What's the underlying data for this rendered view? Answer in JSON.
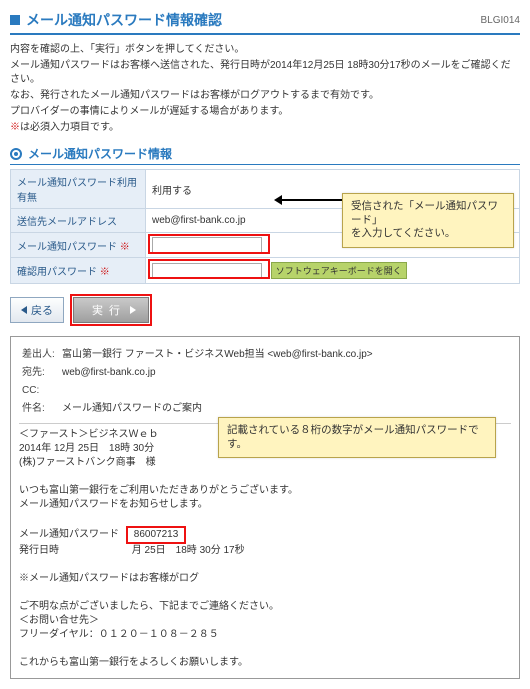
{
  "header": {
    "title": "メール通知パスワード情報確認",
    "code": "BLGI014"
  },
  "intro": {
    "l1": "内容を確認の上、「実行」ボタンを押してください。",
    "l2": "メール通知パスワードはお客様へ送信された、発行日時が2014年12月25日 18時30分17秒のメールをご確認ください。",
    "l3": "なお、発行されたメール通知パスワードはお客様がログアウトするまで有効です。",
    "l4": "プロバイダーの事情によりメールが遅延する場合があります。",
    "l5_mark": "※",
    "l5_text": "は必須入力項目です。"
  },
  "section": {
    "title": "メール通知パスワード情報"
  },
  "table": {
    "r1h": "メール通知パスワード利用有無",
    "r1v": "利用する",
    "r2h": "送信先メールアドレス",
    "r2v": "web@first-bank.co.jp",
    "r3h": "メール通知パスワード",
    "r4h": "確認用パスワード",
    "req": "※",
    "swkb": "ソフトウェアキーボードを開く"
  },
  "buttons": {
    "back": "戻る",
    "exec": "実行"
  },
  "callouts": {
    "c1a": "受信された「メール通知パスワード」",
    "c1b": "を入力してください。",
    "c2": "記載されている８桁の数字がメール通知パスワードです。"
  },
  "mail": {
    "h_from_l": "差出人:",
    "h_from_v": "富山第一銀行 ファースト・ビジネスWeb担当 <web@first-bank.co.jp>",
    "h_to_l": "宛先:",
    "h_to_v": "web@first-bank.co.jp",
    "h_cc_l": "CC:",
    "h_cc_v": "",
    "h_sub_l": "件名:",
    "h_sub_v": "メール通知パスワードのご案内",
    "b1": "＜ファースト＞ビジネスＷｅｂ",
    "b2": "2014年 12月 25日　18時 30分",
    "b3": "(株)ファーストバンク商事　様",
    "b4": "いつも富山第一銀行をご利用いただきありがとうございます。",
    "b5": "メール通知パスワードをお知らせします。",
    "b6l": "メール通知パスワード",
    "b6v": "86007213",
    "b7l": "発行日時",
    "b7v": "月 25日　18時 30分 17秒",
    "b8": "※メール通知パスワードはお客様がログ",
    "b9": "ご不明な点がございましたら、下記までご連絡ください。",
    "b10": "＜お問い合せ先＞",
    "b11": "フリーダイヤル：０１２０－１０８－２８５",
    "b12": "これからも富山第一銀行をよろしくお願いします。"
  }
}
